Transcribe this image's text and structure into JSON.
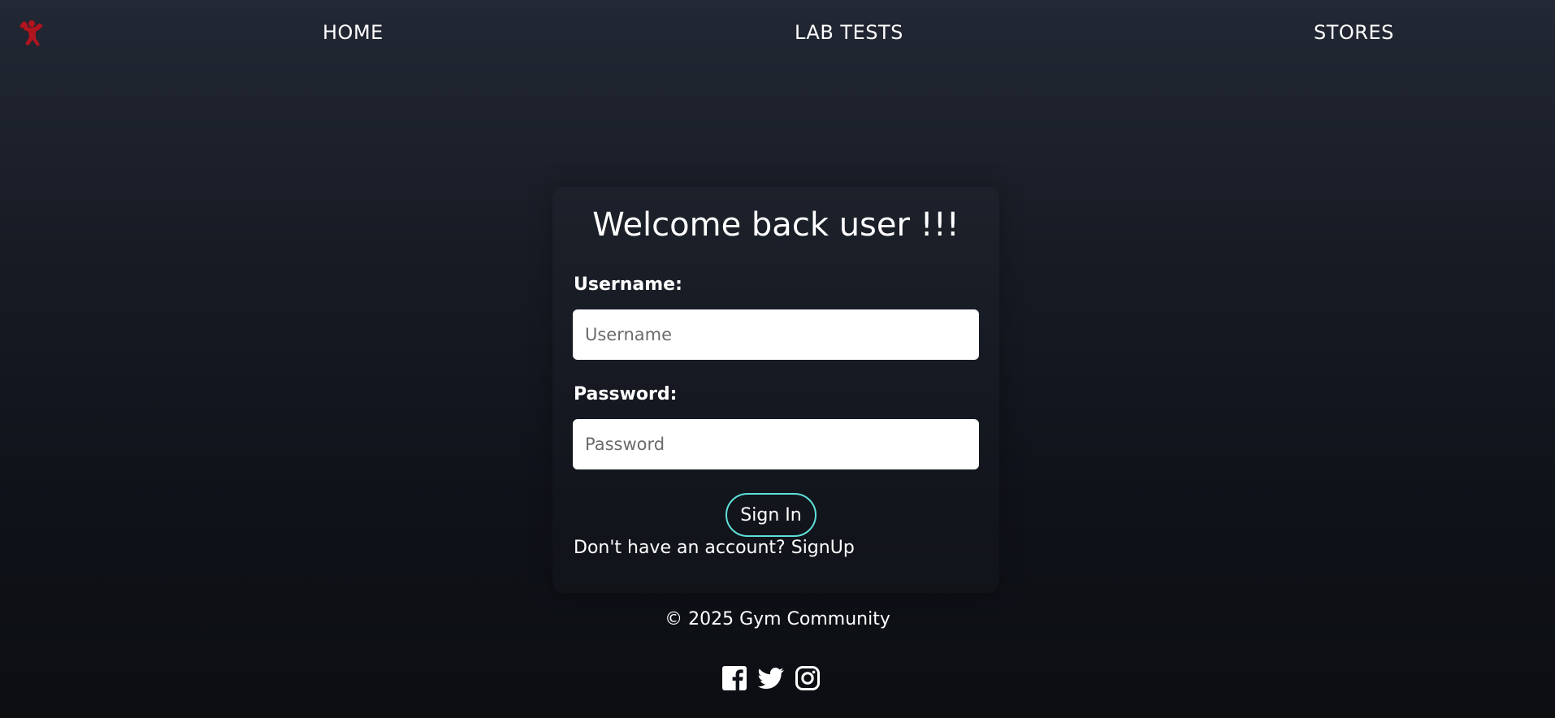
{
  "nav": {
    "logo_icon": "flexing-person-logo-icon",
    "brand_color": "#b0141e",
    "links": [
      {
        "label": "HOME"
      },
      {
        "label": "LAB TESTS"
      },
      {
        "label": "STORES"
      }
    ]
  },
  "login": {
    "title": "Welcome back user !!!",
    "username_label": "Username:",
    "username_placeholder": "Username",
    "username_value": "",
    "password_label": "Password:",
    "password_placeholder": "Password",
    "password_value": "",
    "signin_label": "Sign In",
    "signin_border_color": "#5ee0da",
    "signup_prompt": "Don't have an account?",
    "signup_link": "SignUp"
  },
  "footer": {
    "copyright": "© 2025 Gym Community",
    "socials": [
      {
        "icon": "facebook-icon"
      },
      {
        "icon": "twitter-icon"
      },
      {
        "icon": "instagram-icon"
      }
    ]
  }
}
